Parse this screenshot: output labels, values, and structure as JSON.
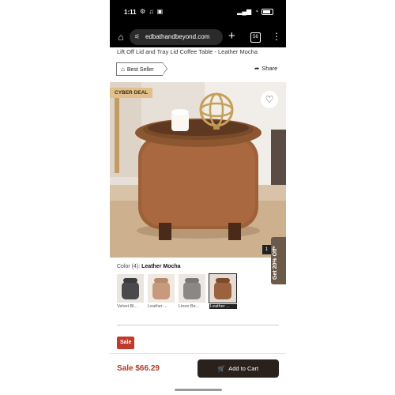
{
  "status": {
    "time": "1:11",
    "left_icons": "⚙ ♫ ▣",
    "battery_icon": "battery-icon"
  },
  "browser": {
    "url": "edbathandbeyond.com",
    "tab_count": "56"
  },
  "product": {
    "title": "Lift Off Lid and Tray Lid Coffee Table - Leather Mocha",
    "best_seller": "Best Seller",
    "share": "Share",
    "cyber_deal": "CYBER DEAL",
    "image_index": "1",
    "promo": "Get 20% Off*",
    "color_label": "Color (4):",
    "color_selected": "Leather Mocha",
    "swatches": [
      {
        "label": "Velvet Bl...",
        "color": "#4a4a4c",
        "selected": false
      },
      {
        "label": "Leather ...",
        "color": "#c79a7d",
        "selected": false
      },
      {
        "label": "Linen Be...",
        "color": "#8a8784",
        "selected": false
      },
      {
        "label": "Leather ...",
        "color": "#9b6240",
        "selected": true
      }
    ],
    "sale_badge": "Sale",
    "price": "Sale $66.29",
    "add_to_cart": "Add to Cart"
  },
  "colors": {
    "accent": "#2b211c",
    "sale": "#c0392b",
    "price": "#b03a1e",
    "cyber": "#e2c08b"
  }
}
